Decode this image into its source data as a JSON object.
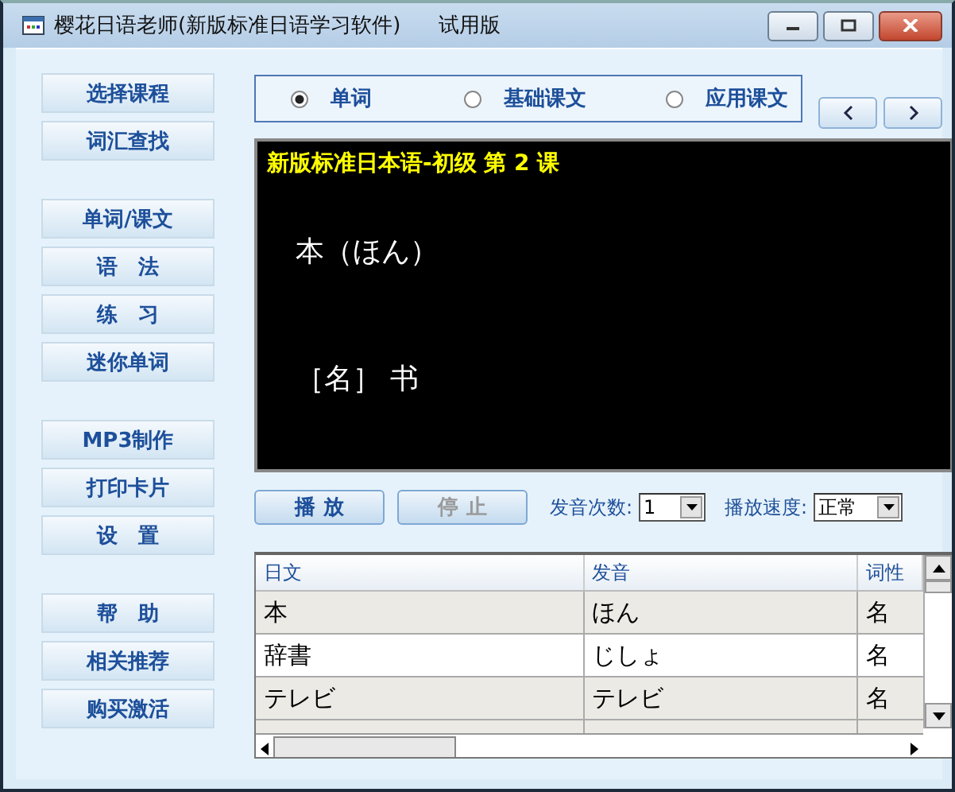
{
  "window": {
    "title": "樱花日语老师(新版标准日语学习软件)",
    "edition": "试用版"
  },
  "sidebar": {
    "groups": [
      {
        "items": [
          {
            "label": "选择课程"
          },
          {
            "label": "词汇查找"
          }
        ]
      },
      {
        "items": [
          {
            "label": "单词/课文"
          },
          {
            "label": "语　法"
          },
          {
            "label": "练　习"
          },
          {
            "label": "迷你单词"
          }
        ]
      },
      {
        "items": [
          {
            "label": "MP3制作"
          },
          {
            "label": "打印卡片"
          },
          {
            "label": "设　置"
          }
        ]
      },
      {
        "items": [
          {
            "label": "帮　助"
          },
          {
            "label": "相关推荐"
          },
          {
            "label": "购买激活"
          }
        ]
      }
    ]
  },
  "mode_radios": [
    {
      "label": "单词",
      "selected": true
    },
    {
      "label": "基础课文",
      "selected": false
    },
    {
      "label": "应用课文",
      "selected": false
    }
  ],
  "display": {
    "heading": "新版标准日本语-初级 第 2 课",
    "word": "本（ほん）",
    "meaning": "［名］ 书"
  },
  "playback": {
    "buttons": [
      {
        "label": "播 放",
        "disabled": false
      },
      {
        "label": "停 止",
        "disabled": true
      }
    ],
    "repeat_label": "发音次数:",
    "repeat_value": "1",
    "speed_label": "播放速度:",
    "speed_value": "正常"
  },
  "table": {
    "columns": [
      "日文",
      "发音",
      "词性"
    ],
    "rows": [
      [
        "本",
        "ほん",
        "名"
      ],
      [
        "辞書",
        "じしょ",
        "名"
      ],
      [
        "テレビ",
        "テレビ",
        "名"
      ]
    ]
  }
}
